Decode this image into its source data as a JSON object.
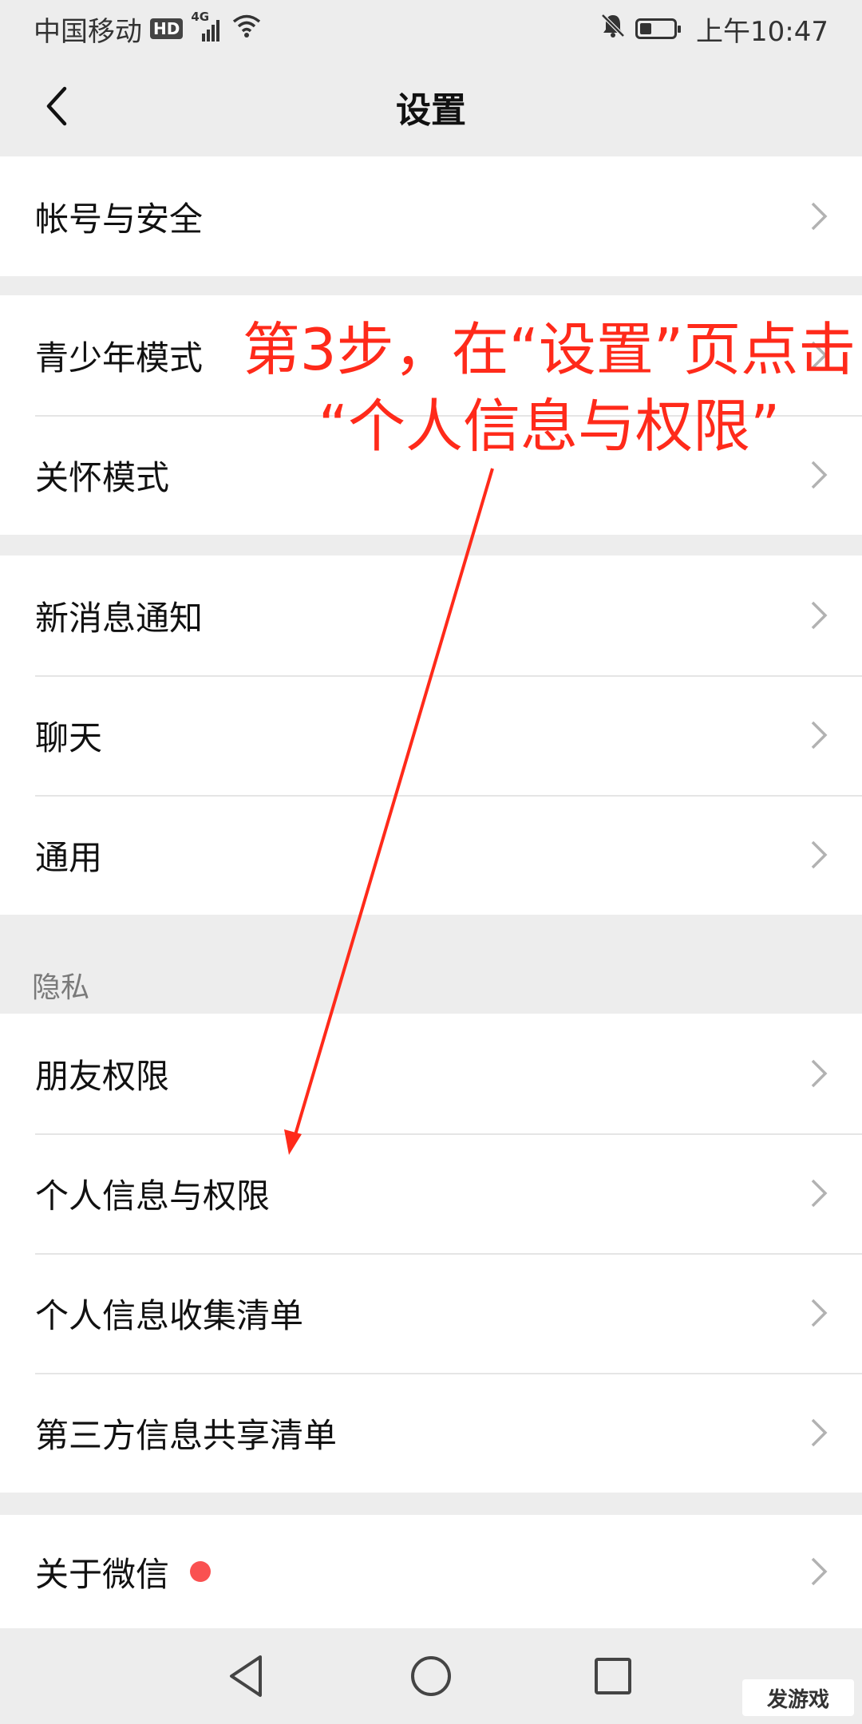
{
  "status_bar": {
    "carrier": "中国移动",
    "hd": "HD",
    "network": "4G",
    "time": "上午10:47",
    "battery_level": 0.35,
    "icons": [
      "hd-icon",
      "signal-icon",
      "wifi-icon",
      "mute-bell-icon",
      "battery-icon"
    ]
  },
  "nav": {
    "title": "设置",
    "back_icon": "chevron-left-icon"
  },
  "groups": [
    {
      "items": [
        {
          "label": "帐号与安全"
        }
      ]
    },
    {
      "items": [
        {
          "label": "青少年模式"
        },
        {
          "label": "关怀模式"
        }
      ]
    },
    {
      "items": [
        {
          "label": "新消息通知"
        },
        {
          "label": "聊天"
        },
        {
          "label": "通用"
        }
      ]
    },
    {
      "section": "隐私",
      "items": [
        {
          "label": "朋友权限"
        },
        {
          "label": "个人信息与权限"
        },
        {
          "label": "个人信息收集清单"
        },
        {
          "label": "第三方信息共享清单"
        }
      ]
    },
    {
      "items": [
        {
          "label": "关于微信",
          "badge": "red-dot"
        }
      ]
    }
  ],
  "annotation": {
    "line1": "第3步，在“设置”页点击",
    "line2": "“个人信息与权限”",
    "color": "#ff2a1a"
  },
  "system_nav": {
    "icons": [
      "back-triangle-icon",
      "home-circle-icon",
      "recents-square-icon"
    ]
  },
  "watermark": "发游戏",
  "colors": {
    "background": "#ededed",
    "card": "#ffffff",
    "chevron": "#b2b2b2",
    "red_dot": "#fa5151",
    "annotation": "#ff2a1a"
  }
}
